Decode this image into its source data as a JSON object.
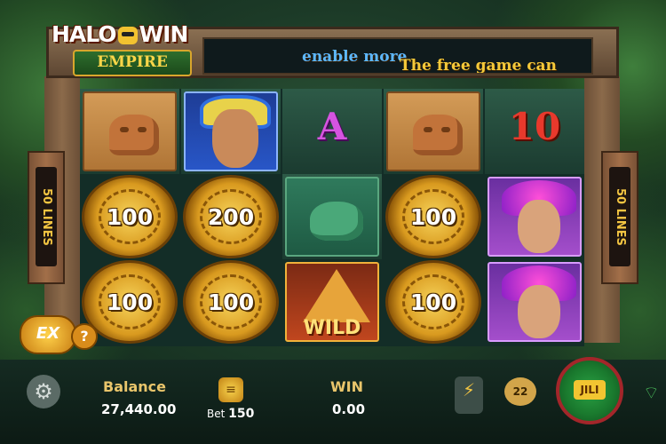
{
  "logo": {
    "line1a": "HALO",
    "line1b": "WIN",
    "line2": "EMPIRE"
  },
  "marquee": {
    "text": "The free game can",
    "highlight": "enable more"
  },
  "lines_label": "50 LINES",
  "reels": [
    [
      "cat",
      "coin:100",
      "coin:100"
    ],
    [
      "warrior",
      "coin:200",
      "coin:100"
    ],
    [
      "A",
      "frog",
      "wild"
    ],
    [
      "cat",
      "coin:100",
      "coin:100"
    ],
    [
      "10",
      "priestess",
      "priestess"
    ]
  ],
  "coins": {
    "r0c1": "100",
    "r0c2": "100",
    "r1c1": "200",
    "r1c2": "100",
    "r3c1": "100",
    "r3c2": "100"
  },
  "symbols": {
    "letter_a": "A",
    "ten": "10",
    "wild": "WILD"
  },
  "ex_button": "EX",
  "help_button": "?",
  "bottom": {
    "balance_label": "Balance",
    "balance_value": "27,440.00",
    "bet_label": "Bet",
    "bet_value": "150",
    "win_label": "WIN",
    "win_value": "0.00",
    "auto_count": "22",
    "spin_brand": "JILI"
  }
}
